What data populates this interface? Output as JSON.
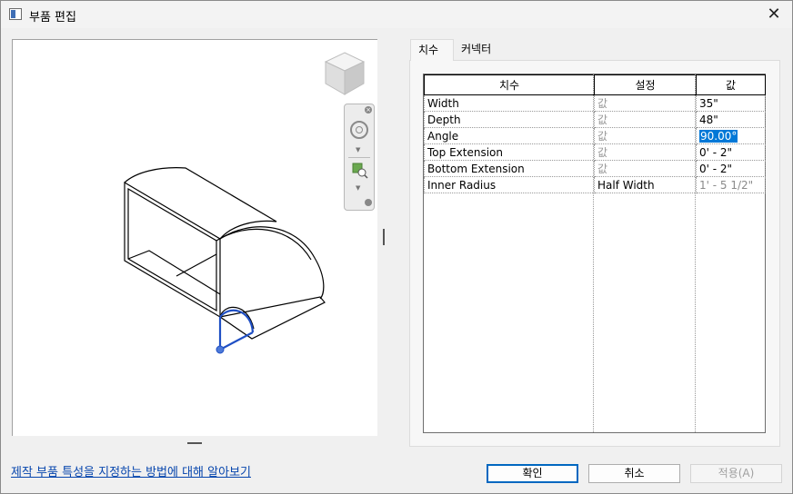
{
  "window": {
    "title": "부품 편집",
    "close_glyph": "✕"
  },
  "tabs": [
    {
      "label": "치수",
      "active": true
    },
    {
      "label": "커넥터",
      "active": false
    }
  ],
  "grid": {
    "headers": [
      "치수",
      "설정",
      "값"
    ],
    "rows": [
      {
        "name": "Width",
        "setting": "값",
        "value": "35\"",
        "selected": false,
        "value_muted": false
      },
      {
        "name": "Depth",
        "setting": "값",
        "value": "48\"",
        "selected": false,
        "value_muted": false
      },
      {
        "name": "Angle",
        "setting": "값",
        "value": "90.00°",
        "selected": true,
        "value_muted": false
      },
      {
        "name": "Top Extension",
        "setting": "값",
        "value": "0' - 2\"",
        "selected": false,
        "value_muted": false
      },
      {
        "name": "Bottom Extension",
        "setting": "값",
        "value": "0' - 2\"",
        "selected": false,
        "value_muted": false
      },
      {
        "name": "Inner Radius",
        "setting": "Half Width",
        "value": "1' - 5 1/2\"",
        "selected": false,
        "value_muted": true
      }
    ]
  },
  "help_link": "제작 부품 특성을 지정하는 방법에 대해 알아보기",
  "buttons": {
    "ok": "확인",
    "cancel": "취소",
    "apply": "적용(A)"
  },
  "colors": {
    "accent": "#0067c0",
    "selection": "#0078d7",
    "preview_highlight": "#1f4fc4"
  },
  "icons": [
    "viewcube-icon",
    "steering-wheel-icon",
    "zoom-icon",
    "close-icon"
  ]
}
